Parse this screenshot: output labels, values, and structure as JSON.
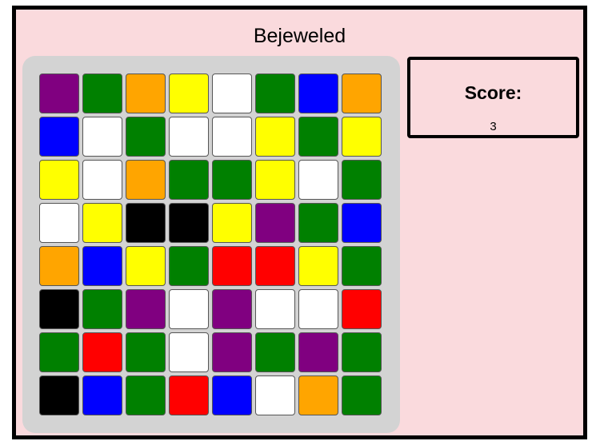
{
  "game": {
    "title": "Bejeweled"
  },
  "score": {
    "label": "Score:",
    "value": "3"
  },
  "colors": {
    "purple": "#800080",
    "green": "#008000",
    "orange": "#ffa500",
    "yellow": "#ffff00",
    "white": "#ffffff",
    "blue": "#0000ff",
    "black": "#000000",
    "red": "#ff0000"
  },
  "board": {
    "rows": [
      [
        "purple",
        "green",
        "orange",
        "yellow",
        "white",
        "green",
        "blue",
        "orange"
      ],
      [
        "blue",
        "white",
        "green",
        "white",
        "white",
        "yellow",
        "green",
        "yellow"
      ],
      [
        "yellow",
        "white",
        "orange",
        "green",
        "green",
        "yellow",
        "white",
        "green"
      ],
      [
        "white",
        "yellow",
        "black",
        "black",
        "yellow",
        "purple",
        "green",
        "blue"
      ],
      [
        "orange",
        "blue",
        "yellow",
        "green",
        "red",
        "red",
        "yellow",
        "green"
      ],
      [
        "black",
        "green",
        "purple",
        "white",
        "purple",
        "white",
        "white",
        "red"
      ],
      [
        "green",
        "red",
        "green",
        "white",
        "purple",
        "green",
        "purple",
        "green"
      ],
      [
        "black",
        "blue",
        "green",
        "red",
        "blue",
        "white",
        "orange",
        "green"
      ]
    ]
  }
}
